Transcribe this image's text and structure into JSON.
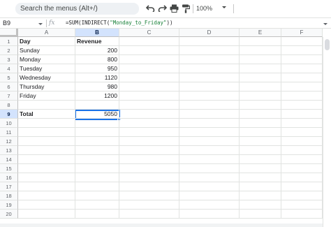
{
  "toolbar": {
    "menu_search_label": "Search the menus (Alt+/)",
    "zoom_value": "100%"
  },
  "formula_bar": {
    "cell_ref": "B9",
    "fx_label": "fx",
    "formula_prefix": "=SUM(INDIRECT(",
    "formula_string": "\"Monday_to_Friday\"",
    "formula_suffix": "))"
  },
  "grid": {
    "columns": [
      "A",
      "B",
      "C",
      "D",
      "E",
      "F"
    ],
    "active_column": "B",
    "row_numbers": [
      "1",
      "2",
      "3",
      "4",
      "5",
      "6",
      "7",
      "8",
      "9",
      "10",
      "11",
      "12",
      "13",
      "14",
      "15",
      "16",
      "17",
      "18",
      "19",
      "20"
    ],
    "active_row": "9",
    "rows": [
      {
        "a": "Day",
        "b": "Revenue"
      },
      {
        "a": "Sunday",
        "b": "200"
      },
      {
        "a": "Monday",
        "b": "800"
      },
      {
        "a": "Tuesday",
        "b": "950"
      },
      {
        "a": "Wednesday",
        "b": "1120"
      },
      {
        "a": "Thursday",
        "b": "980"
      },
      {
        "a": "Friday",
        "b": "1200"
      },
      {
        "a": "",
        "b": ""
      },
      {
        "a": "Total",
        "b": "5050"
      }
    ]
  },
  "colors": {
    "selection": "#1a73e8",
    "header_active": "#d3e3fd",
    "formula_string": "#188038"
  }
}
